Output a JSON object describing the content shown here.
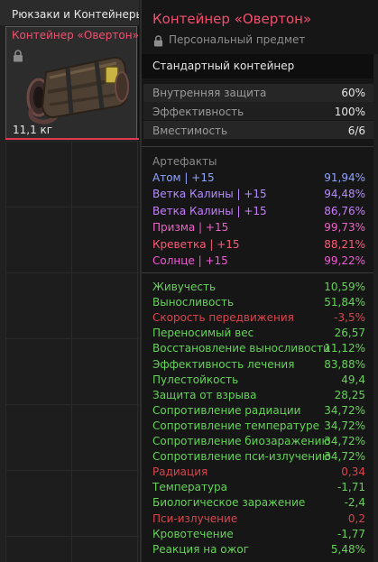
{
  "inventory": {
    "category": "Рюкзаки и Контейнеры",
    "item_name": "Контейнер «Овертон»",
    "item_weight": "11,1 кг"
  },
  "tooltip": {
    "title": "Контейнер «Овертон»",
    "subtitle": "Персональный предмет",
    "item_type": "Стандартный контейнер",
    "base_stats": [
      {
        "label": "Внутренняя защита",
        "value": "60%"
      },
      {
        "label": "Эффективность",
        "value": "100%"
      },
      {
        "label": "Вместимость",
        "value": "6/6"
      }
    ],
    "artifacts_header": "Артефакты",
    "artifacts": [
      {
        "label": "Атом | +15",
        "value": "91,94%",
        "color": "#8fa3ff"
      },
      {
        "label": "Ветка Калины | +15",
        "value": "94,48%",
        "color": "#b48cff"
      },
      {
        "label": "Ветка Калины | +15",
        "value": "86,76%",
        "color": "#c77dff"
      },
      {
        "label": "Призма | +15",
        "value": "99,73%",
        "color": "#ee63c8"
      },
      {
        "label": "Креветка | +15",
        "value": "88,21%",
        "color": "#ff5a76"
      },
      {
        "label": "Солнце | +15",
        "value": "99,22%",
        "color": "#f05ad6"
      }
    ],
    "effects": [
      {
        "label": "Живучесть",
        "value": "10,59%",
        "color": "#66d25a"
      },
      {
        "label": "Выносливость",
        "value": "51,84%",
        "color": "#66d25a"
      },
      {
        "label": "Скорость передвижения",
        "value": "-3,5%",
        "color": "#d9454d"
      },
      {
        "label": "Переносимый вес",
        "value": "26,57",
        "color": "#66d25a"
      },
      {
        "label": "Восстановление выносливости",
        "value": "11,12%",
        "color": "#66d25a"
      },
      {
        "label": "Эффективность лечения",
        "value": "83,88%",
        "color": "#66d25a"
      },
      {
        "label": "Пулестойкость",
        "value": "49,4",
        "color": "#66d25a"
      },
      {
        "label": "Защита от взрыва",
        "value": "28,25",
        "color": "#66d25a"
      },
      {
        "label": "Сопротивление радиации",
        "value": "34,72%",
        "color": "#66d25a"
      },
      {
        "label": "Сопротивление температуре",
        "value": "34,72%",
        "color": "#66d25a"
      },
      {
        "label": "Сопротивление биозаражению",
        "value": "34,72%",
        "color": "#66d25a"
      },
      {
        "label": "Сопротивление пси-излучению",
        "value": "34,72%",
        "color": "#66d25a"
      },
      {
        "label": "Радиация",
        "value": "0,34",
        "color": "#d9454d"
      },
      {
        "label": "Температура",
        "value": "-1,71",
        "color": "#66d25a"
      },
      {
        "label": "Биологическое заражение",
        "value": "-2,4",
        "color": "#66d25a"
      },
      {
        "label": "Пси-излучение",
        "value": "0,2",
        "color": "#d9454d"
      },
      {
        "label": "Кровотечение",
        "value": "-1,77",
        "color": "#66d25a"
      },
      {
        "label": "Реакция на ожог",
        "value": "5,48%",
        "color": "#66d25a"
      }
    ]
  },
  "colors": {
    "accent": "#f0506e",
    "positive": "#66d25a",
    "negative": "#d9454d"
  },
  "icons": [
    "lock-icon",
    "container-item-icon"
  ]
}
